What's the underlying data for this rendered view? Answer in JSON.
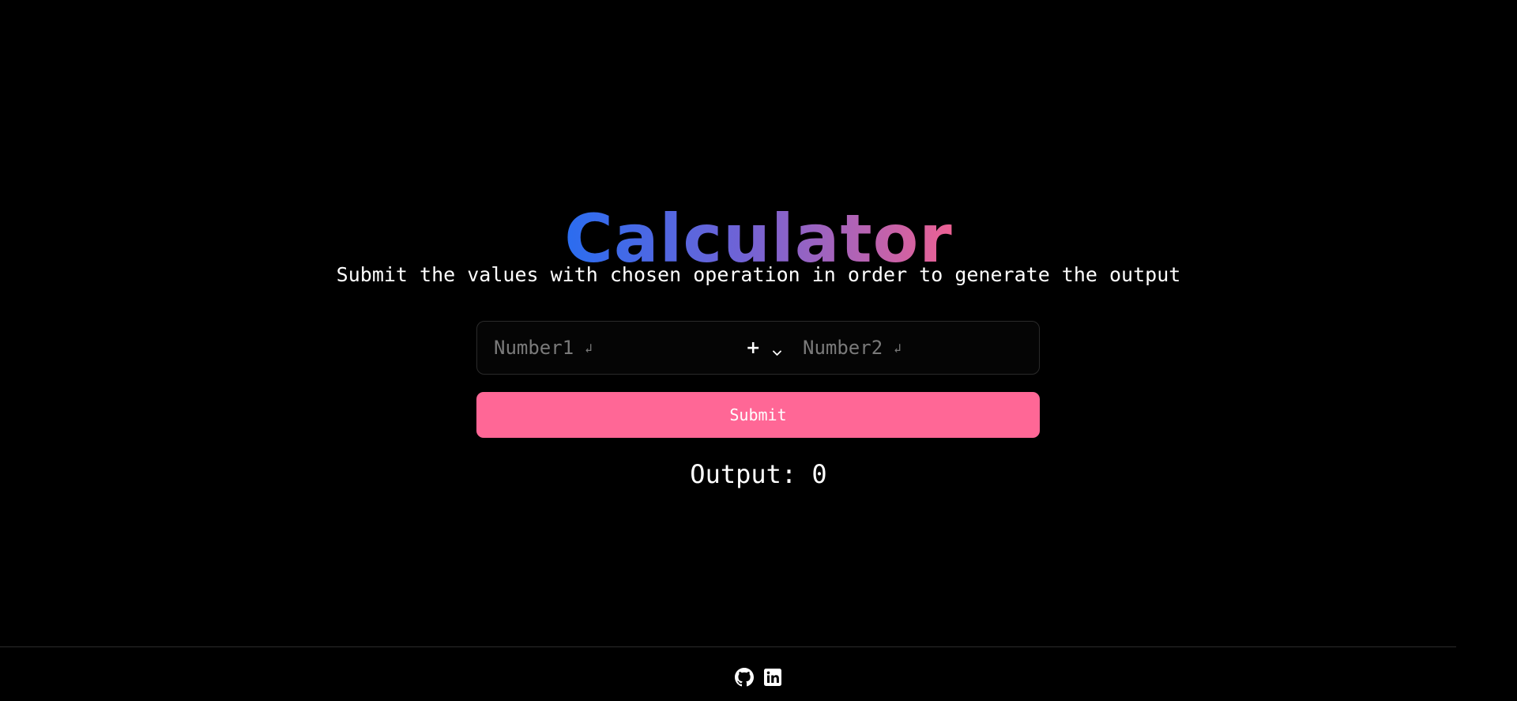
{
  "header": {
    "title": "Calculator",
    "title_gradient": [
      "#2a6df0",
      "#6f63d6",
      "#b163b5",
      "#ec6193"
    ]
  },
  "instructions": "Submit the values with chosen operation in order to generate the output",
  "form": {
    "number1_placeholder": "Number1",
    "number2_placeholder": "Number2",
    "enter_glyph": "↲",
    "operation": {
      "selected": "+",
      "icon": "chevron-down-icon"
    },
    "submit_label": "Submit",
    "submit_color": "#ff6796"
  },
  "output": {
    "label": "Output:",
    "value": "0"
  },
  "footer": {
    "icons": [
      "github-icon",
      "linkedin-icon"
    ]
  }
}
